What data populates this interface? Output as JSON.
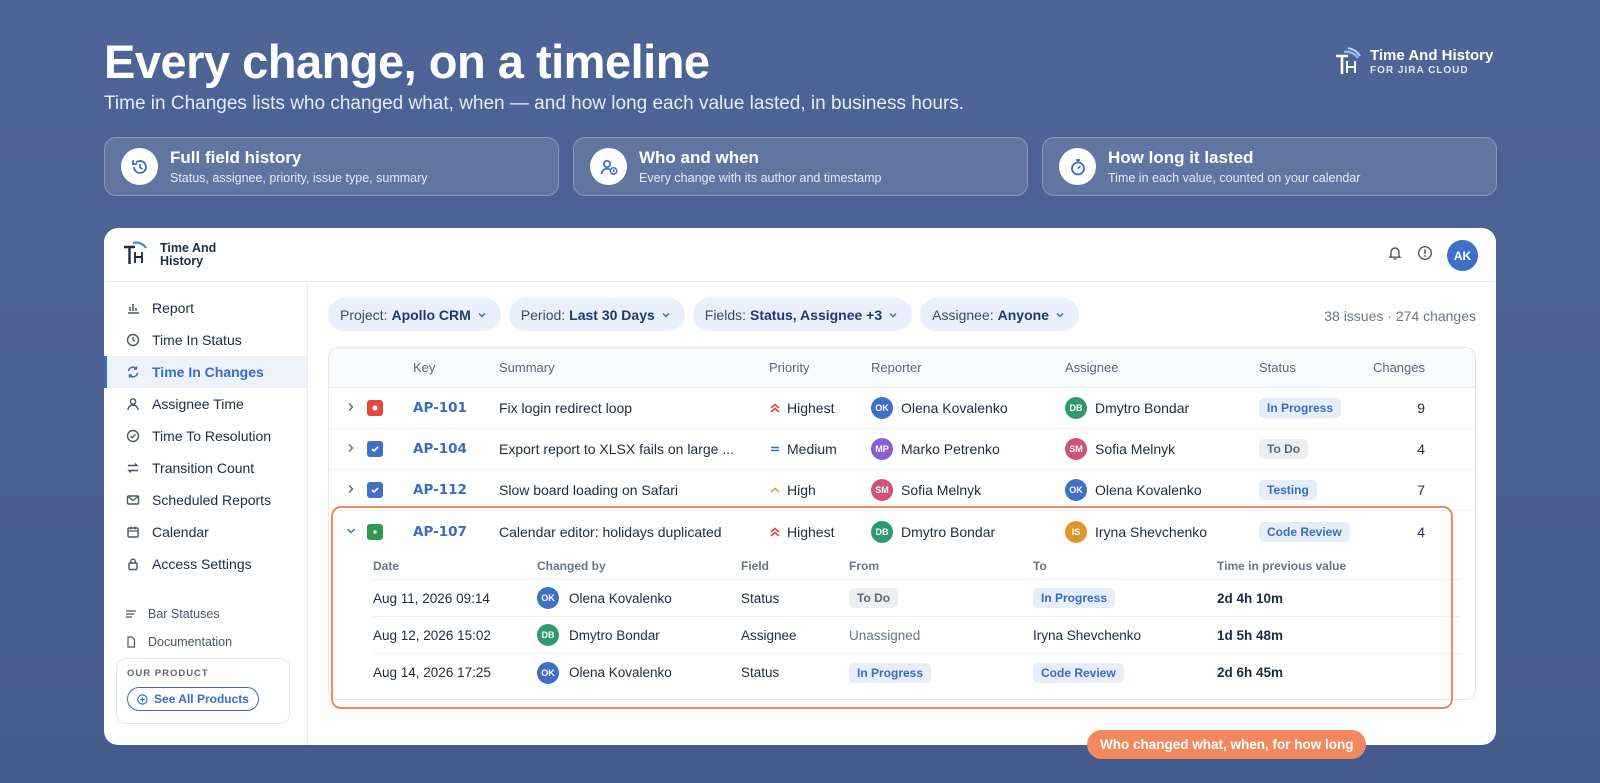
{
  "hero": {
    "title": "Every change, on a timeline",
    "subtitle": "Time in Changes lists who changed what, when — and how long each value lasted, in business hours."
  },
  "brand": {
    "name": "Time And History",
    "sub": "FOR JIRA CLOUD"
  },
  "features": [
    {
      "title": "Full field history",
      "desc": "Status, assignee, priority, issue type, summary",
      "icon": "history-icon"
    },
    {
      "title": "Who and when",
      "desc": "Every change with its author and timestamp",
      "icon": "user-clock-icon"
    },
    {
      "title": "How long it lasted",
      "desc": "Time in each value, counted on your calendar",
      "icon": "stopwatch-icon"
    }
  ],
  "app": {
    "logo_line1": "Time And",
    "logo_line2": "History",
    "user_initials": "AK"
  },
  "sidebar": {
    "items": [
      {
        "label": "Report",
        "icon": "bar-chart-icon"
      },
      {
        "label": "Time In Status",
        "icon": "clock-icon"
      },
      {
        "label": "Time In Changes",
        "icon": "refresh-icon",
        "active": true
      },
      {
        "label": "Assignee Time",
        "icon": "user-icon"
      },
      {
        "label": "Time To Resolution",
        "icon": "check-circle-icon"
      },
      {
        "label": "Transition Count",
        "icon": "swap-icon"
      },
      {
        "label": "Scheduled Reports",
        "icon": "mail-icon"
      },
      {
        "label": "Calendar",
        "icon": "calendar-icon"
      },
      {
        "label": "Access Settings",
        "icon": "lock-icon"
      }
    ],
    "small_items": [
      {
        "label": "Bar Statuses",
        "icon": "list-icon"
      },
      {
        "label": "Documentation",
        "icon": "document-icon"
      }
    ],
    "product_label": "OUR PRODUCT",
    "product_button": "See All Products"
  },
  "filters": [
    {
      "label": "Project:",
      "value": "Apollo CRM"
    },
    {
      "label": "Period:",
      "value": "Last 30 Days"
    },
    {
      "label": "Fields:",
      "value": "Status, Assignee +3"
    },
    {
      "label": "Assignee:",
      "value": "Anyone"
    }
  ],
  "counts": "38 issues · 274 changes",
  "table": {
    "headers": {
      "key": "Key",
      "summary": "Summary",
      "priority": "Priority",
      "reporter": "Reporter",
      "assignee": "Assignee",
      "status": "Status",
      "changes": "Changes"
    },
    "rows": [
      {
        "key": "AP-101",
        "summary": "Fix login redirect loop",
        "priority": "Highest",
        "reporter": "Olena Kovalenko",
        "reporter_initials": "OK",
        "assignee": "Dmytro Bondar",
        "assignee_initials": "DB",
        "status": "In Progress",
        "changes": "9"
      },
      {
        "key": "AP-104",
        "summary": "Export report to XLSX fails on large ...",
        "priority": "Medium",
        "reporter": "Marko Petrenko",
        "reporter_initials": "MP",
        "assignee": "Sofia Melnyk",
        "assignee_initials": "SM",
        "status": "To Do",
        "changes": "4"
      },
      {
        "key": "AP-112",
        "summary": "Slow board loading on Safari",
        "priority": "High",
        "reporter": "Sofia Melnyk",
        "reporter_initials": "SM",
        "assignee": "Olena Kovalenko",
        "assignee_initials": "OK",
        "status": "Testing",
        "changes": "7"
      },
      {
        "key": "AP-107",
        "summary": "Calendar editor: holidays duplicated",
        "priority": "Highest",
        "reporter": "Dmytro Bondar",
        "reporter_initials": "DB",
        "assignee": "Iryna Shevchenko",
        "assignee_initials": "IS",
        "status": "Code Review",
        "changes": "4"
      }
    ],
    "history_headers": {
      "date": "Date",
      "by": "Changed by",
      "field": "Field",
      "from": "From",
      "to": "To",
      "time": "Time in previous value"
    },
    "history": [
      {
        "date": "Aug 11, 2026 09:14",
        "by": "Olena Kovalenko",
        "by_initials": "OK",
        "field": "Status",
        "from": "To Do",
        "to": "In Progress",
        "time": "2d 4h 10m"
      },
      {
        "date": "Aug 12, 2026 15:02",
        "by": "Dmytro Bondar",
        "by_initials": "DB",
        "field": "Assignee",
        "from": "Unassigned",
        "to": "Iryna Shevchenko",
        "time": "1d 5h 48m"
      },
      {
        "date": "Aug 14, 2026 17:25",
        "by": "Olena Kovalenko",
        "by_initials": "OK",
        "field": "Status",
        "from": "In Progress",
        "to": "Code Review",
        "time": "2d 6h 45m"
      }
    ]
  },
  "callout": "Who changed what, when, for how long",
  "colors": {
    "accent": "#3b6cc2",
    "highlight": "#f2895e",
    "bug": "#e2483d",
    "task": "#3f6fc6",
    "story": "#2e9a4f"
  }
}
